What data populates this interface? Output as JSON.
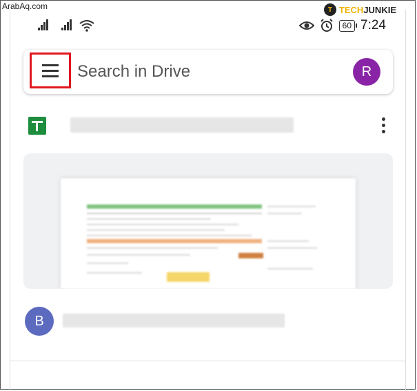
{
  "watermark": {
    "left_text": "ArabAq.com",
    "logo_letter": "T",
    "brand_tech": "TECH",
    "brand_junkie": "JUNKIE",
    "brand_color": "#f0b400"
  },
  "status_bar": {
    "battery": "60",
    "time": "7:24",
    "icons": [
      "signal-icon",
      "signal-icon",
      "wifi-icon",
      "eye-icon",
      "alarm-icon",
      "battery-icon"
    ]
  },
  "search": {
    "placeholder": "Search in Drive",
    "menu_icon": "hamburger-menu-icon",
    "highlight_color": "#e0171f",
    "account_initial": "R",
    "account_color": "#8a24a6"
  },
  "files": [
    {
      "icon": "google-sheets-icon",
      "icon_color": "#1e8e3e",
      "more_icon": "more-vert-icon"
    }
  ],
  "shared_by": {
    "initial": "B",
    "color": "#5c6bc0"
  }
}
